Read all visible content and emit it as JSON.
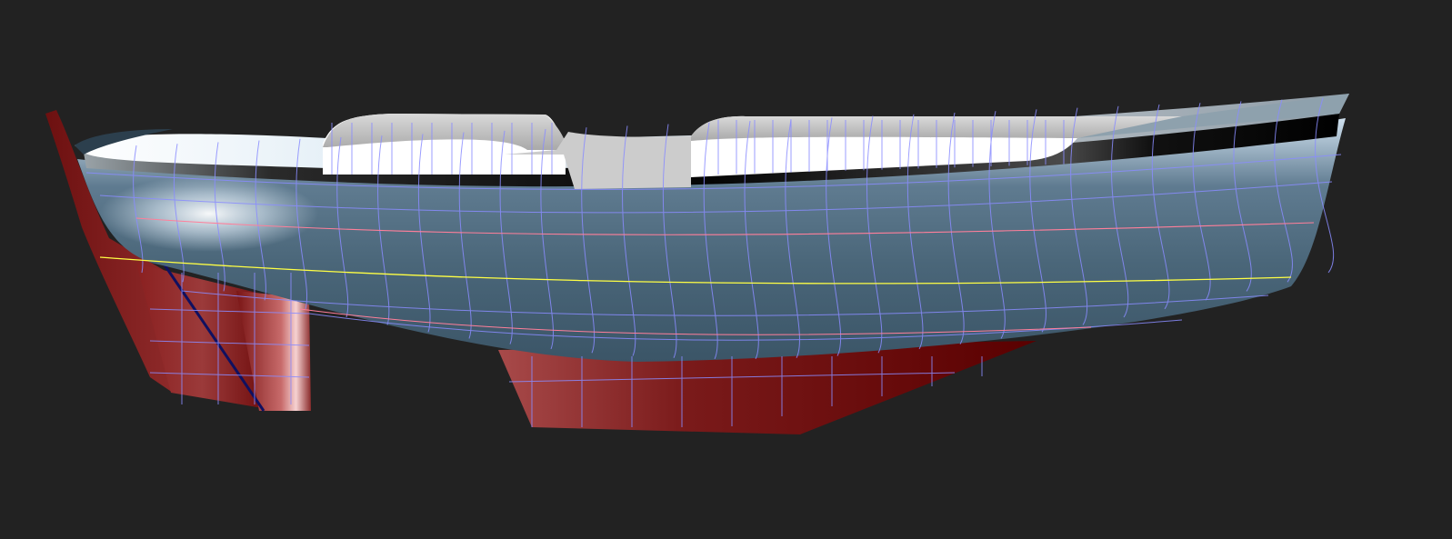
{
  "viewport": {
    "background": "#222222"
  },
  "model": {
    "colors": {
      "hull": "#4f6b7f",
      "hull_highlight": "#eef4fa",
      "sheer_stripe": "#050505",
      "deck": "#9a9a9a",
      "cabin": "#ffffff",
      "cabin_top": "#bdbdbd",
      "appendage_dark": "#5e0000",
      "appendage_light": "#b04a4a",
      "rudder_highlight": "#f2c9c9",
      "wireframe": "#8a8cff",
      "waterline": "#ffff44",
      "buttock_line": "#ff7f9a"
    }
  }
}
